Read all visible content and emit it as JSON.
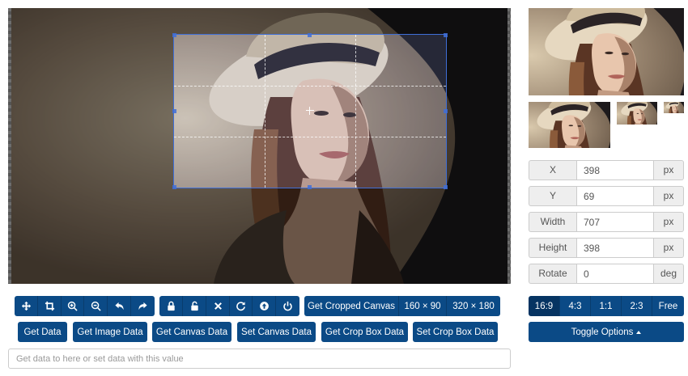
{
  "preview_image": {
    "description_icon": "portrait-photo"
  },
  "fields": [
    {
      "label": "X",
      "value": "398",
      "unit": "px"
    },
    {
      "label": "Y",
      "value": "69",
      "unit": "px"
    },
    {
      "label": "Width",
      "value": "707",
      "unit": "px"
    },
    {
      "label": "Height",
      "value": "398",
      "unit": "px"
    },
    {
      "label": "Rotate",
      "value": "0",
      "unit": "deg"
    }
  ],
  "toolbar": {
    "tool_icons": [
      "move-icon",
      "crop-icon",
      "zoom-in-icon",
      "zoom-out-icon",
      "rotate-left-icon",
      "rotate-right-icon"
    ],
    "state_icons": [
      "lock-icon",
      "unlock-icon",
      "clear-icon",
      "reset-icon",
      "upload-icon",
      "power-icon"
    ],
    "cropped_canvas": {
      "label": "Get Cropped Canvas",
      "size1": "160 × 90",
      "size2": "320 × 180"
    }
  },
  "data_buttons": [
    "Get Data",
    "Get Image Data",
    "Get Canvas Data",
    "Set Canvas Data",
    "Get Crop Box Data",
    "Set Crop Box Data"
  ],
  "data_input": {
    "placeholder": "Get data to here or set data with this value"
  },
  "ratios": {
    "options": [
      "16:9",
      "4:3",
      "1:1",
      "2:3",
      "Free"
    ],
    "selected": "16:9"
  },
  "toggle_options": {
    "label": "Toggle Options"
  },
  "colors": {
    "primary": "#0b4a86",
    "active": "#063462",
    "crop_outline": "#3f6fd8"
  }
}
